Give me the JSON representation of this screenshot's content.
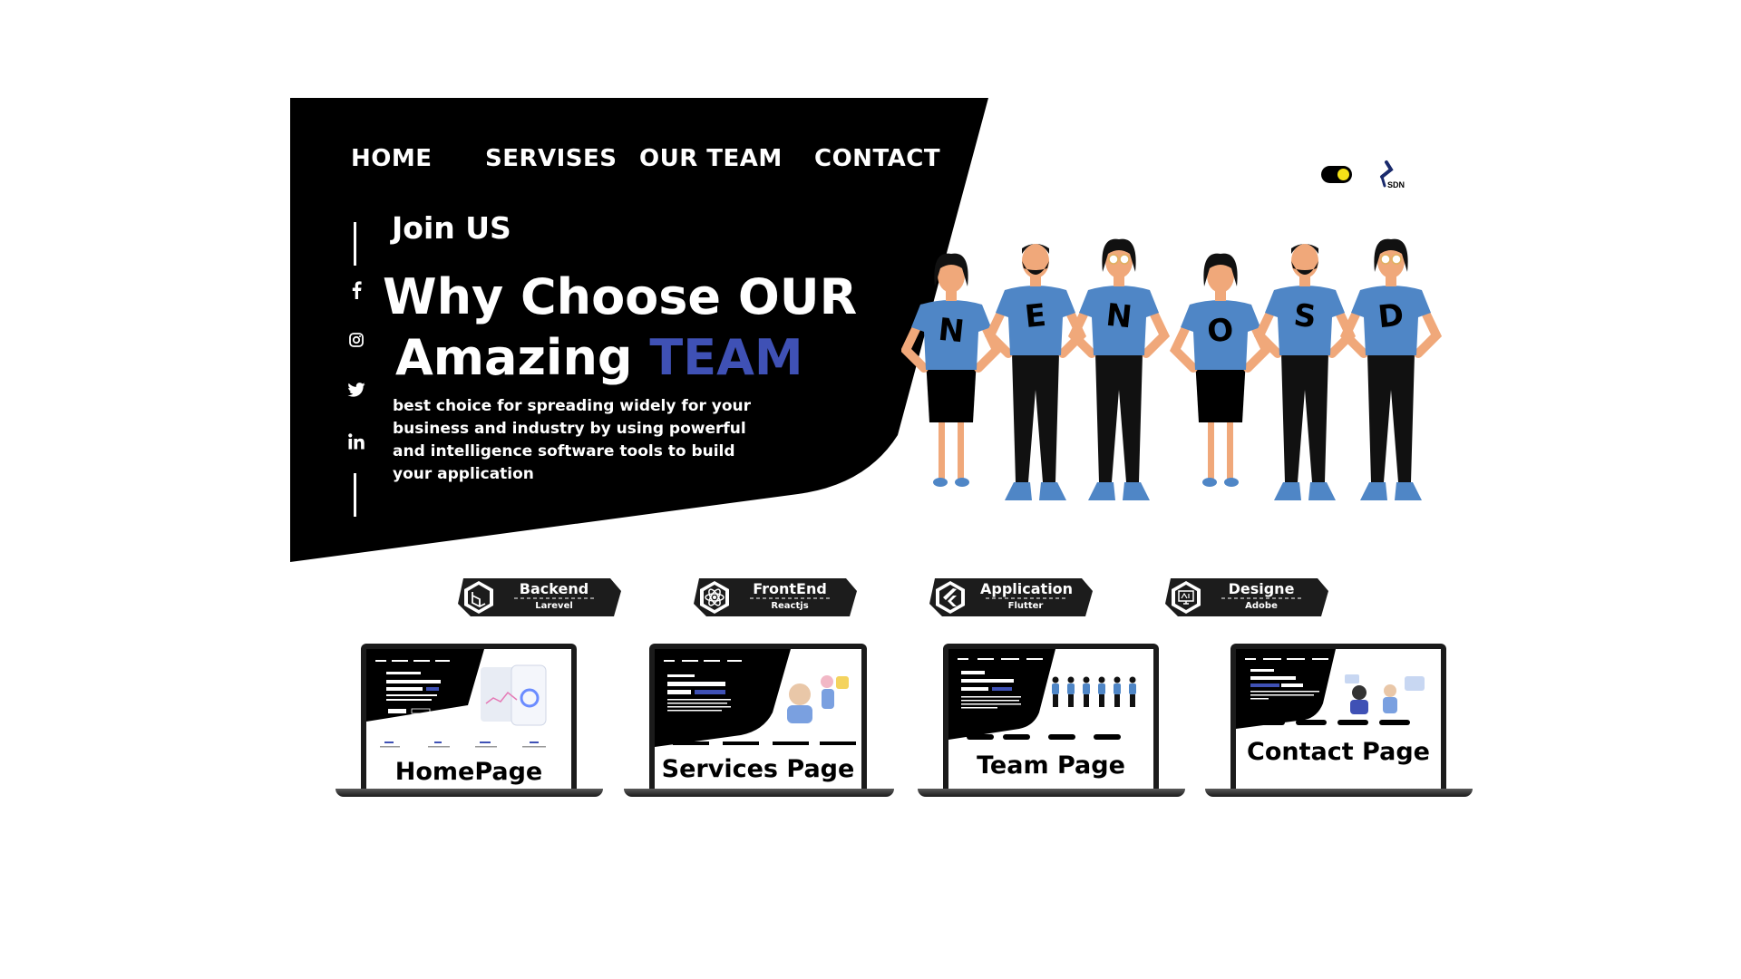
{
  "nav": {
    "home": "HOME",
    "services": "SERVISES",
    "team": "OUR TEAM",
    "contact": "CONTACT"
  },
  "hero": {
    "join": "Join US",
    "title_line1": "Why Choose OUR",
    "title_line2_prefix": "Amazing",
    "title_line2_accent": "TEAM",
    "description": "best choice for spreading widely for your business and industry by using powerful and intelligence software tools to build your application"
  },
  "social_icons": [
    "facebook-icon",
    "instagram-icon",
    "twitter-icon",
    "linkedin-icon"
  ],
  "theme_toggle": {
    "state": "on",
    "knob_color": "#f5e218"
  },
  "logo": {
    "text": "SDN"
  },
  "team_letters": [
    "S",
    "D",
    "N",
    "O",
    "N",
    "E"
  ],
  "badges": [
    {
      "title": "Backend",
      "subtitle": "Larevel",
      "icon": "laravel-icon"
    },
    {
      "title": "FrontEnd",
      "subtitle": "Reactjs",
      "icon": "react-icon"
    },
    {
      "title": "Application",
      "subtitle": "Flutter",
      "icon": "flutter-icon"
    },
    {
      "title": "Designe",
      "subtitle": "Adobe",
      "icon": "adobe-icon"
    }
  ],
  "pages": [
    {
      "label": "HomePage"
    },
    {
      "label": "Services Page"
    },
    {
      "label": "Team Page"
    },
    {
      "label": "Contact Page"
    }
  ],
  "colors": {
    "accent": "#3f51b5",
    "hero_bg": "#000000",
    "shirt": "#4f86c6",
    "badge_bg": "#1c1c1c"
  }
}
